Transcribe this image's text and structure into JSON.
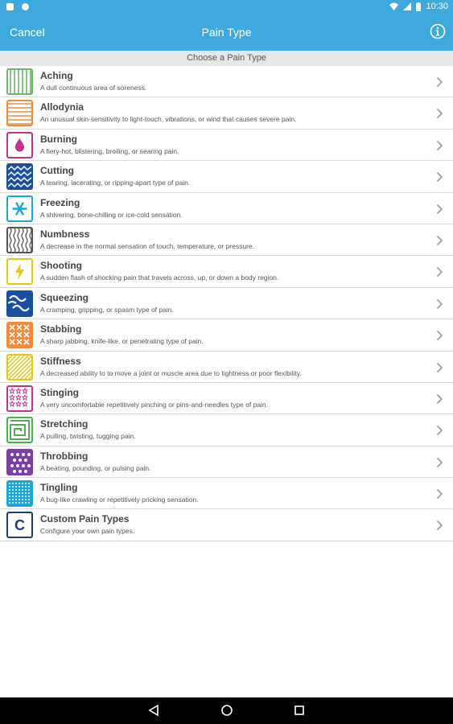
{
  "status": {
    "time": "10:30"
  },
  "header": {
    "cancel_label": "Cancel",
    "title": "Pain Type"
  },
  "section": {
    "title": "Choose a Pain Type"
  },
  "items": [
    {
      "name": "Aching",
      "desc": "A dull continuous area of soreness.",
      "color": "#6ab86a",
      "icon": "vertical-lines-pattern-icon"
    },
    {
      "name": "Allodynia",
      "desc": "An unusual skin-sensitivity to light-touch, vibrations, or wind that causes severe pain.",
      "color": "#f08a3c",
      "icon": "horizontal-lines-pattern-icon"
    },
    {
      "name": "Burning",
      "desc": "A fiery-hot, blistering, broiling, or searing pain.",
      "color": "#c2338d",
      "icon": "flame-icon"
    },
    {
      "name": "Cutting",
      "desc": "A tearing, lacerating, or ripping-apart type of pain.",
      "color": "#1a4fa0",
      "icon": "zigzag-pattern-icon"
    },
    {
      "name": "Freezing",
      "desc": "A shivering, bone-chilling or ice-cold sensation.",
      "color": "#1aa6d8",
      "icon": "snowflake-icon"
    },
    {
      "name": "Numbness",
      "desc": "A decrease in the normal sensation of touch, temperature, or pressure.",
      "color": "#555555",
      "icon": "wavy-lines-pattern-icon"
    },
    {
      "name": "Shooting",
      "desc": "A sudden flash of shocking pain that travels across, up, or down a body region.",
      "color": "#e3c81c",
      "icon": "lightning-bolt-icon"
    },
    {
      "name": "Squeezing",
      "desc": "A cramping, gripping, or spasm type of pain.",
      "color": "#1a4fa0",
      "icon": "wave-pattern-icon"
    },
    {
      "name": "Stabbing",
      "desc": "A sharp jabbing, knife-like, or penetrating type of pain.",
      "color": "#f08a3c",
      "icon": "cross-pattern-icon"
    },
    {
      "name": "Stiffness",
      "desc": "A decreased ability to to move a joint or muscle area due to tightness or poor flexibility.",
      "color": "#e3c81c",
      "icon": "diagonal-lines-pattern-icon"
    },
    {
      "name": "Stinging",
      "desc": "A very uncomfortable repetitively pinching or pins-and-needles type of pain.",
      "color": "#c2338d",
      "icon": "stars-pattern-icon"
    },
    {
      "name": "Stretching",
      "desc": "A pulling, twisting, tugging pain.",
      "color": "#4caf50",
      "icon": "maze-pattern-icon"
    },
    {
      "name": "Throbbing",
      "desc": "A beating, pounding, or pulsing pain.",
      "color": "#7a3fa8",
      "icon": "circles-pattern-icon"
    },
    {
      "name": "Tingling",
      "desc": "A bug-like crawling or repetitively pricking sensation.",
      "color": "#1aa6d8",
      "icon": "dots-pattern-icon"
    },
    {
      "name": "Custom Pain Types",
      "desc": "Configure your own pain types.",
      "color": "#1f3a78",
      "icon": "letter-c-icon",
      "letter": "C"
    }
  ]
}
